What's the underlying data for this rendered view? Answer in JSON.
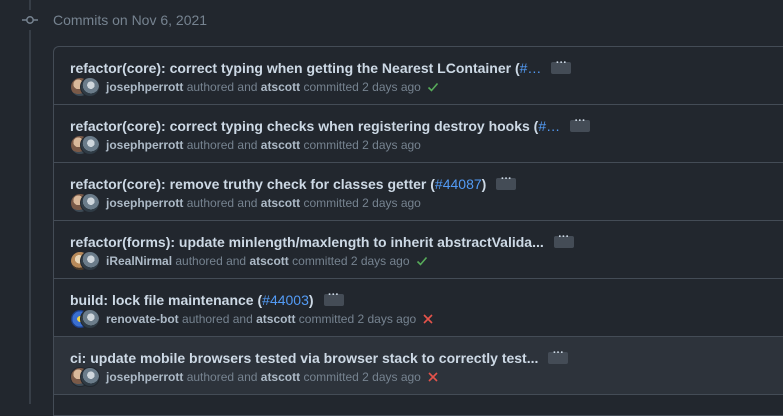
{
  "date_header": "Commits on Nov 6, 2021",
  "colors": {
    "success": "#57ab5a",
    "failure": "#e5534b",
    "link": "#539bf5"
  },
  "commits": [
    {
      "title": "refactor(core): correct typing when getting the Nearest LContainer (",
      "pr": "#…",
      "title_end": "",
      "author": "josephperrott",
      "authored": "authored and",
      "committer": "atscott",
      "committed": "committed 2 days ago",
      "status": "success"
    },
    {
      "title": "refactor(core): correct typing checks when registering destroy hooks (",
      "pr": "#…",
      "title_end": "",
      "author": "josephperrott",
      "authored": "authored and",
      "committer": "atscott",
      "committed": "committed 2 days ago",
      "status": "none"
    },
    {
      "title": "refactor(core): remove truthy check for classes getter (",
      "pr": "#44087",
      "title_end": ")",
      "author": "josephperrott",
      "authored": "authored and",
      "committer": "atscott",
      "committed": "committed 2 days ago",
      "status": "none"
    },
    {
      "title": "refactor(forms): update minlength/maxlength to inherit abstractValida...",
      "pr": "",
      "title_end": "",
      "author": "iRealNirmal",
      "authored": "authored and",
      "committer": "atscott",
      "committed": "committed 2 days ago",
      "status": "success"
    },
    {
      "title": "build: lock file maintenance (",
      "pr": "#44003",
      "title_end": ")",
      "author": "renovate-bot",
      "authored": "authored and",
      "committer": "atscott",
      "committed": "committed 2 days ago",
      "status": "failure"
    },
    {
      "title": "ci: update mobile browsers tested via browser stack to correctly test...",
      "pr": "",
      "title_end": "",
      "author": "josephperrott",
      "authored": "authored and",
      "committer": "atscott",
      "committed": "committed 2 days ago",
      "status": "failure"
    }
  ],
  "ellipsis_label": "···"
}
